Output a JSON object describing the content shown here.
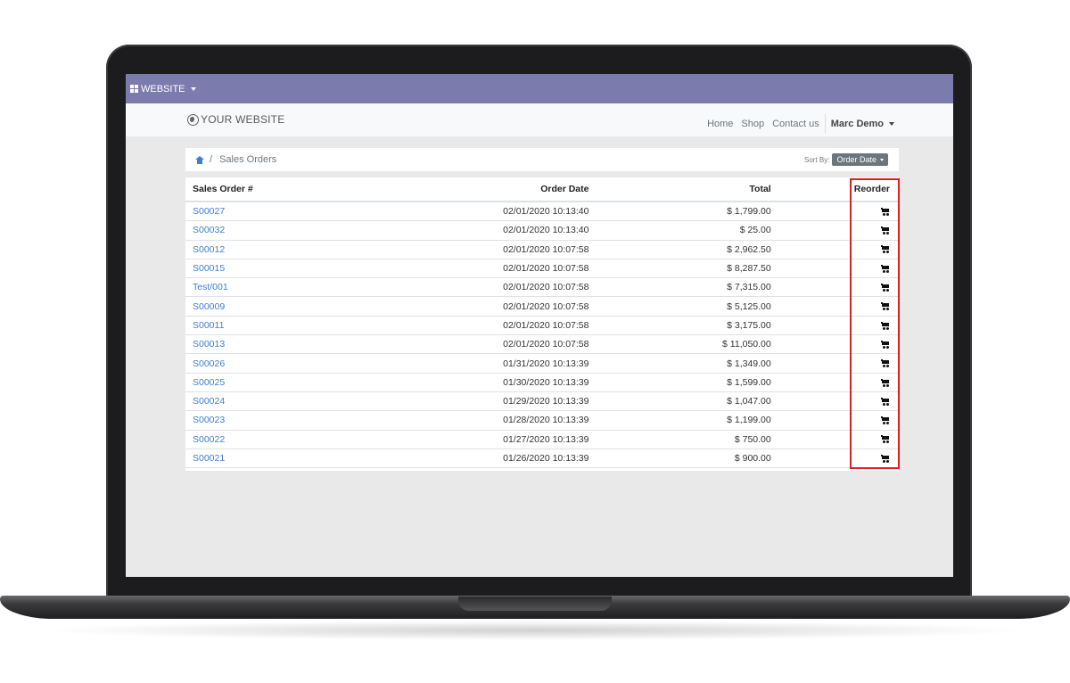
{
  "topbar": {
    "label": "WEBSITE"
  },
  "navbar": {
    "logo": "YOUR WEBSITE",
    "links": [
      "Home",
      "Shop",
      "Contact us"
    ],
    "user": "Marc Demo"
  },
  "breadcrumb": {
    "current": "Sales Orders"
  },
  "sort": {
    "label": "Sort By:",
    "value": "Order Date"
  },
  "table": {
    "headers": [
      "Sales Order #",
      "Order Date",
      "Total",
      "Reorder"
    ],
    "rows": [
      {
        "id": "S00027",
        "date": "02/01/2020  10:13:40",
        "total": "$ 1,799.00"
      },
      {
        "id": "S00032",
        "date": "02/01/2020  10:13:40",
        "total": "$ 25.00"
      },
      {
        "id": "S00012",
        "date": "02/01/2020  10:07:58",
        "total": "$ 2,962.50"
      },
      {
        "id": "S00015",
        "date": "02/01/2020  10:07:58",
        "total": "$ 8,287.50"
      },
      {
        "id": "Test/001",
        "date": "02/01/2020  10:07:58",
        "total": "$ 7,315.00"
      },
      {
        "id": "S00009",
        "date": "02/01/2020  10:07:58",
        "total": "$ 5,125.00"
      },
      {
        "id": "S00011",
        "date": "02/01/2020  10:07:58",
        "total": "$ 3,175.00"
      },
      {
        "id": "S00013",
        "date": "02/01/2020  10:07:58",
        "total": "$ 11,050.00"
      },
      {
        "id": "S00026",
        "date": "01/31/2020  10:13:39",
        "total": "$ 1,349.00"
      },
      {
        "id": "S00025",
        "date": "01/30/2020  10:13:39",
        "total": "$ 1,599.00"
      },
      {
        "id": "S00024",
        "date": "01/29/2020  10:13:39",
        "total": "$ 1,047.00"
      },
      {
        "id": "S00023",
        "date": "01/28/2020  10:13:39",
        "total": "$ 1,199.00"
      },
      {
        "id": "S00022",
        "date": "01/27/2020  10:13:39",
        "total": "$ 750.00"
      },
      {
        "id": "S00021",
        "date": "01/26/2020  10:13:39",
        "total": "$ 900.00"
      }
    ]
  },
  "icons": {
    "reorder": "shopping-cart-icon",
    "home": "home-icon",
    "apps": "grid-icon",
    "logo": "globe-icon"
  },
  "colors": {
    "topbar": "#7c7bad",
    "link": "#3d7fd6",
    "highlight": "#e02020"
  }
}
